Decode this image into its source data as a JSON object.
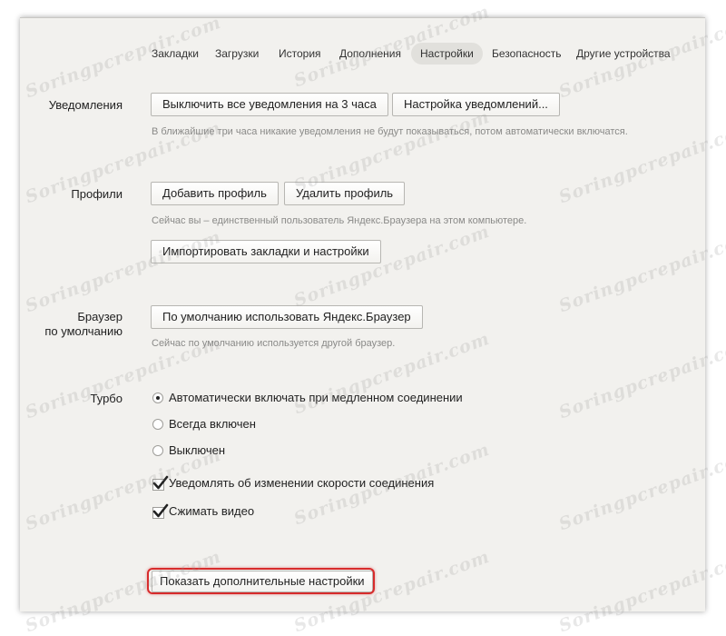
{
  "tabs": [
    {
      "label": "Закладки"
    },
    {
      "label": "Загрузки"
    },
    {
      "label": "История"
    },
    {
      "label": "Дополнения"
    },
    {
      "label": "Настройки"
    },
    {
      "label": "Безопасность"
    },
    {
      "label": "Другие устройства"
    }
  ],
  "active_tab": "Настройки",
  "notifications": {
    "label": "Уведомления",
    "disable_button": "Выключить все уведомления на 3 часа",
    "settings_button": "Настройка уведомлений...",
    "hint": "В ближайшие три часа никакие уведомления не будут показываться, потом автоматически включатся."
  },
  "profiles": {
    "label": "Профили",
    "add_button": "Добавить профиль",
    "delete_button": "Удалить профиль",
    "hint": "Сейчас вы – единственный пользователь Яндекс.Браузера на этом компьютере.",
    "import_button": "Импортировать закладки и настройки"
  },
  "default_browser": {
    "label_line1": "Браузер",
    "label_line2": "по умолчанию",
    "button": "По умолчанию использовать Яндекс.Браузер",
    "hint": "Сейчас по умолчанию используется другой браузер."
  },
  "turbo": {
    "label": "Турбо",
    "options": [
      {
        "label": "Автоматически включать при медленном соединении",
        "selected": true
      },
      {
        "label": "Всегда включен",
        "selected": false
      },
      {
        "label": "Выключен",
        "selected": false
      }
    ],
    "checkboxes": [
      {
        "label": "Уведомлять об изменении скорости соединения",
        "checked": true
      },
      {
        "label": "Сжимать видео",
        "checked": true
      }
    ]
  },
  "show_more_button": "Показать дополнительные настройки",
  "watermark": "Soringpcrepair.com",
  "colors": {
    "highlight": "#d72b2b",
    "panel_bg": "#f2f1ee",
    "active_tab_bg": "#e1e0dc"
  }
}
